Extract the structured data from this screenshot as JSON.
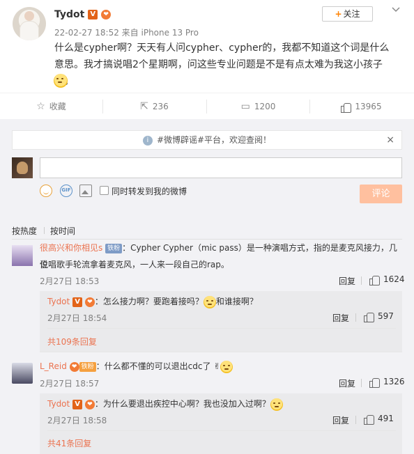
{
  "post": {
    "username": "Tydot",
    "verified_badge": "V",
    "heart_badge": "❤",
    "meta": "22-02-27 18:52 来自 iPhone 13 Pro",
    "follow_label": "关注",
    "follow_plus": "+",
    "text": "什么是cypher啊？天天有人问cypher、cypher的，我都不知道这个词是什么意思。我才搞说唱2个星期啊，问这些专业问题是不是有点太难为我这小孩子了。"
  },
  "actions": {
    "favorite": "收藏",
    "repost": "236",
    "comment": "1200",
    "like": "13965"
  },
  "notice": {
    "text": "#微博辟谣#平台，欢迎查阅！",
    "close": "×"
  },
  "composer": {
    "placeholder": "",
    "gif_label": "GIF",
    "repost_label": "同时转发到我的微博",
    "submit_label": "评论"
  },
  "sort": {
    "hot": "按热度",
    "time": "按时间"
  },
  "comments": [
    {
      "name": "很高兴和你相见s",
      "badge": "铁粉",
      "text_1": "：Cypher Cypher（mic pass）是一种演唱方式，指的是麦克风接力，几位",
      "text_2": "说唱歌手轮流拿着麦克风，一人来一段自己的rap。",
      "time": "2月27日 18:53",
      "reply": "回复",
      "likes": "1624",
      "sub": {
        "name": "Tydot",
        "text": "：怎么接力啊？要跑着接吗？",
        "text_after": "和谁接啊？",
        "time": "2月27日 18:54",
        "reply": "回复",
        "likes": "597"
      },
      "more": "共109条回复"
    },
    {
      "name": "L_Reid",
      "badge": "铁粉",
      "text": "：什么都不懂的可以退出cdc了",
      "time": "2月27日 18:57",
      "reply": "回复",
      "likes": "1326",
      "sub": {
        "name": "Tydot",
        "text": "：为什么要退出疾控中心啊？我也没加入过啊？",
        "time": "2月27日 18:58",
        "reply": "回复",
        "likes": "491"
      },
      "more": "共41条回复"
    }
  ],
  "colors": {
    "accent": "#eb7350",
    "follow_plus": "#ff8200",
    "submit_bg": "#ffc09f",
    "panel_bg": "#f2f2f5"
  }
}
